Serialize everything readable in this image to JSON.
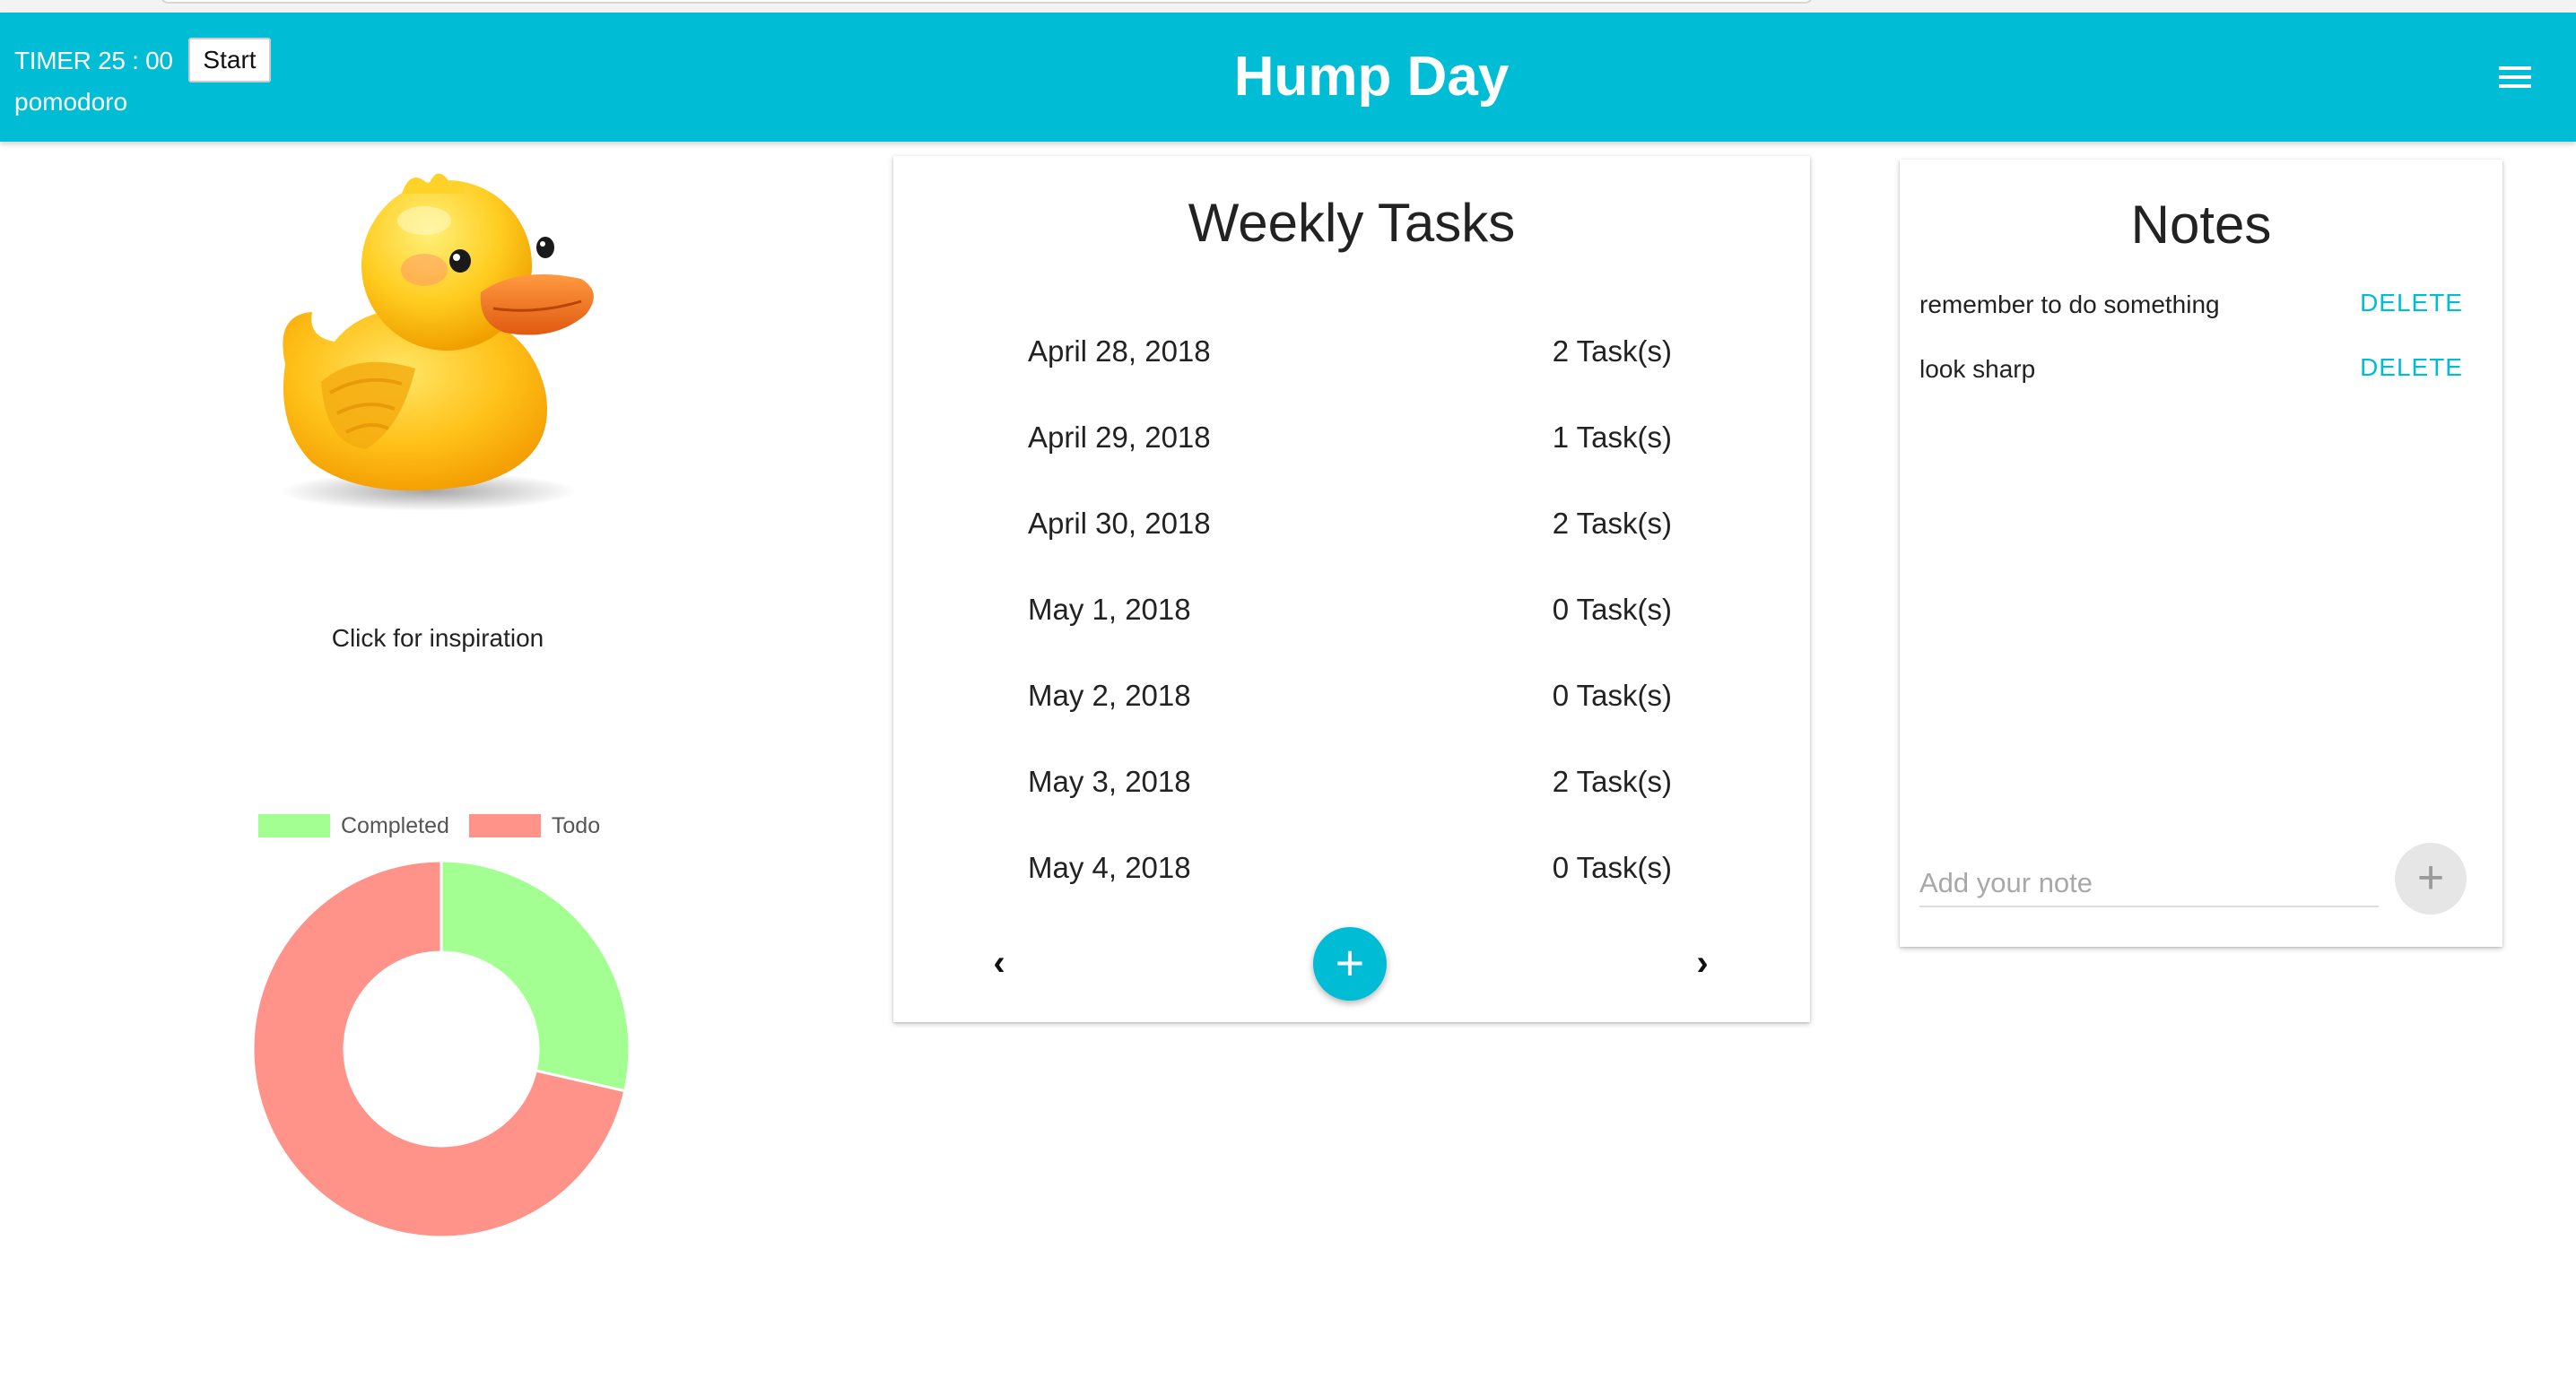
{
  "header": {
    "timer_label": "TIMER 25 : 00",
    "start_label": "Start",
    "pomodoro_label": "pomodoro",
    "title": "Hump Day",
    "menu_icon": "hamburger-menu-icon",
    "bg_color": "#00bcd4"
  },
  "inspiration": {
    "image": "rubber-duck",
    "caption": "Click for inspiration"
  },
  "chart_data": {
    "type": "pie",
    "variant": "doughnut",
    "labels": [
      "Completed",
      "Todo"
    ],
    "values": [
      2,
      5
    ],
    "colors": [
      "#a4ff92",
      "#ff938a"
    ],
    "legend": "top"
  },
  "weekly_tasks": {
    "title": "Weekly Tasks",
    "days": [
      {
        "date": "April 28, 2018",
        "count": "2 Task(s)"
      },
      {
        "date": "April 29, 2018",
        "count": "1 Task(s)"
      },
      {
        "date": "April 30, 2018",
        "count": "2 Task(s)"
      },
      {
        "date": "May 1, 2018",
        "count": "0 Task(s)"
      },
      {
        "date": "May 2, 2018",
        "count": "0 Task(s)"
      },
      {
        "date": "May 3, 2018",
        "count": "2 Task(s)"
      },
      {
        "date": "May 4, 2018",
        "count": "0 Task(s)"
      }
    ],
    "prev_icon": "chevron-left-icon",
    "next_icon": "chevron-right-icon",
    "add_icon": "plus-icon"
  },
  "notes": {
    "title": "Notes",
    "items": [
      {
        "text": "remember to do something",
        "action": "DELETE"
      },
      {
        "text": "look sharp",
        "action": "DELETE"
      }
    ],
    "input_placeholder": "Add your note",
    "input_value": "",
    "add_icon": "plus-icon"
  }
}
